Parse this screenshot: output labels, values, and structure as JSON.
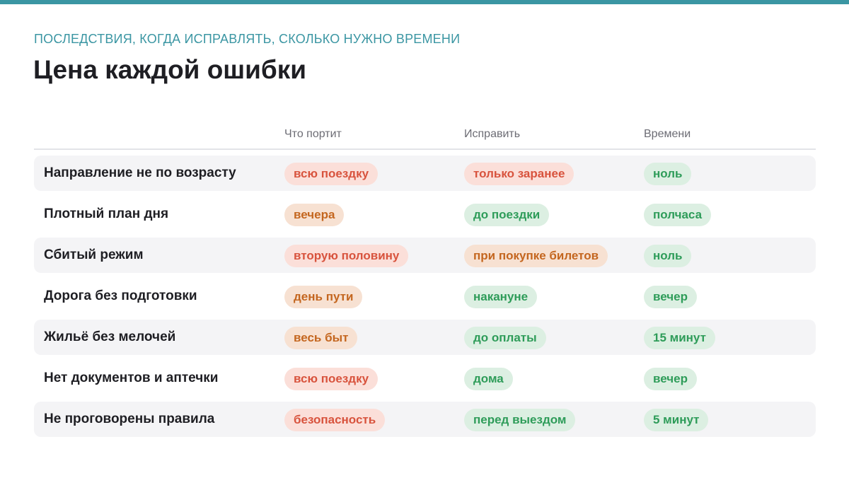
{
  "header": {
    "subtitle": "ПОСЛЕДСТВИЯ, КОГДА ИСПРАВЛЯТЬ, СКОЛЬКО НУЖНО ВРЕМЕНИ",
    "title": "Цена каждой ошибки"
  },
  "colors": {
    "accent": "#3b96a3",
    "red_text": "#d8533d",
    "red_bg": "#fbdfd9",
    "orange_text": "#c4661f",
    "orange_bg": "#f7e1d2",
    "green_text": "#2e9c59",
    "green_bg": "#dcefe2"
  },
  "table": {
    "columns": [
      "Что портит",
      "Исправить",
      "Времени"
    ],
    "rows": [
      {
        "label": "Направление не по возрасту",
        "damage": {
          "text": "всю поездку",
          "tone": "red"
        },
        "fix": {
          "text": "только заранее",
          "tone": "red"
        },
        "time": {
          "text": "ноль",
          "tone": "green"
        }
      },
      {
        "label": "Плотный план дня",
        "damage": {
          "text": "вечера",
          "tone": "orange"
        },
        "fix": {
          "text": "до поездки",
          "tone": "green"
        },
        "time": {
          "text": "полчаса",
          "tone": "green"
        }
      },
      {
        "label": "Сбитый режим",
        "damage": {
          "text": "вторую половину",
          "tone": "red"
        },
        "fix": {
          "text": "при покупке билетов",
          "tone": "orange"
        },
        "time": {
          "text": "ноль",
          "tone": "green"
        }
      },
      {
        "label": "Дорога без подготовки",
        "damage": {
          "text": "день пути",
          "tone": "orange"
        },
        "fix": {
          "text": "накануне",
          "tone": "green"
        },
        "time": {
          "text": "вечер",
          "tone": "green"
        }
      },
      {
        "label": "Жильё без мелочей",
        "damage": {
          "text": "весь быт",
          "tone": "orange"
        },
        "fix": {
          "text": "до оплаты",
          "tone": "green"
        },
        "time": {
          "text": "15 минут",
          "tone": "green"
        }
      },
      {
        "label": "Нет документов и аптечки",
        "damage": {
          "text": "всю поездку",
          "tone": "red"
        },
        "fix": {
          "text": "дома",
          "tone": "green"
        },
        "time": {
          "text": "вечер",
          "tone": "green"
        }
      },
      {
        "label": "Не проговорены правила",
        "damage": {
          "text": "безопасность",
          "tone": "red"
        },
        "fix": {
          "text": "перед выездом",
          "tone": "green"
        },
        "time": {
          "text": "5 минут",
          "tone": "green"
        }
      }
    ]
  }
}
